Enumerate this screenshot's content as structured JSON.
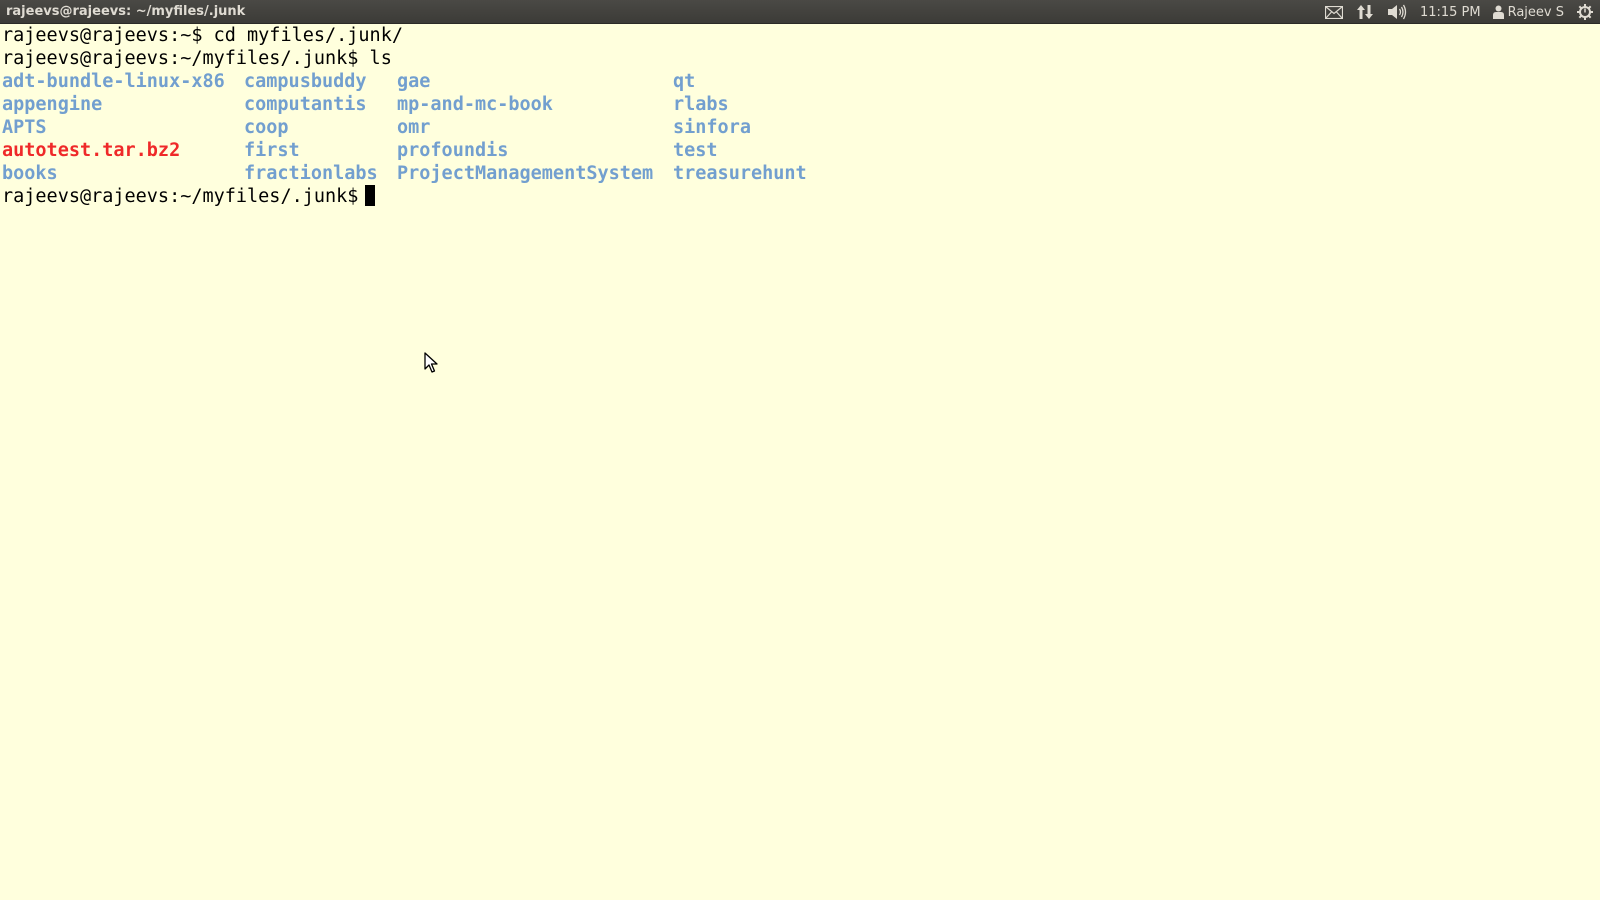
{
  "panel": {
    "window_title": "rajeevs@rajeevs: ~/myfiles/.junk",
    "indicators": {
      "mail_icon": "envelope-icon",
      "network_icon": "network-updown-icon",
      "sound_icon": "speaker-icon",
      "clock": "11:15 PM",
      "user_name": "Rajeev S",
      "session_icon": "gear-power-icon"
    },
    "colors": {
      "panel_bg": "#3c3b37",
      "panel_text": "#dfdbd2"
    }
  },
  "terminal": {
    "background": "#ffffdd",
    "lines": {
      "line1": "rajeevs@rajeevs:~$ cd myfiles/.junk/",
      "line2": "rajeevs@rajeevs:~/myfiles/.junk$ ls",
      "prompt": "rajeevs@rajeevs:~/myfiles/.junk$"
    },
    "ls_output": {
      "col1": [
        "adt-bundle-linux-x86",
        "appengine",
        "APTS",
        "autotest.tar.bz2",
        "books"
      ],
      "col2": [
        "campusbuddy",
        "computantis",
        "coop",
        "first",
        "fractionlabs"
      ],
      "col3": [
        "gae",
        "mp-and-mc-book",
        "omr",
        "profoundis",
        "ProjectManagementSystem"
      ],
      "col4": [
        "qt",
        "rlabs",
        "sinfora",
        "test",
        "treasurehunt"
      ]
    },
    "colors": {
      "directory": "#729fcf",
      "archive": "#ef2929",
      "text": "#000000"
    }
  }
}
